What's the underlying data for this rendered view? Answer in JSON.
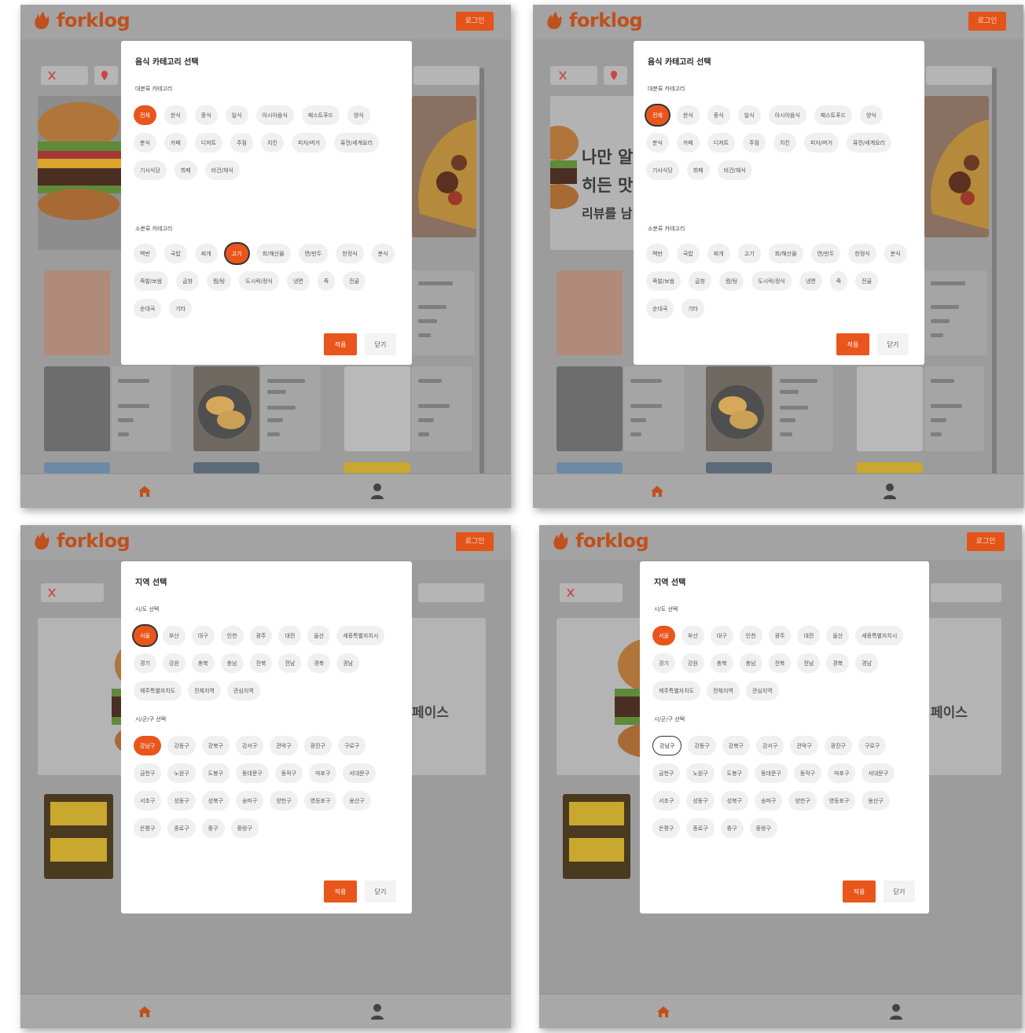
{
  "app": {
    "logo_text": "forklog",
    "login_label": "로그인"
  },
  "accent_color": "#e8561c",
  "icons": [
    "home-icon",
    "user-icon",
    "utensils-icon",
    "location-pin-icon",
    "forklog-logo-icon"
  ],
  "panel_1": {
    "modal_title": "음식 카테고리 선택",
    "major_label": "대분류 카테고리",
    "major_chips": [
      "전체",
      "한식",
      "중식",
      "일식",
      "아시아음식",
      "패스트푸드",
      "양식",
      "분식",
      "카페",
      "디저트",
      "주점",
      "치킨",
      "피자/버거",
      "퓨전/세계요리",
      "기사식당",
      "뷔페",
      "비건/채식"
    ],
    "minor_label": "소분류 카테고리",
    "minor_chips": [
      "백반",
      "국밥",
      "찌개",
      "고기",
      "회/해산물",
      "면/만두",
      "한정식",
      "분식",
      "족발/보쌈",
      "곱창",
      "찜/탕",
      "도시락/정식",
      "냉면",
      "죽",
      "전골",
      "순대국",
      "기타"
    ],
    "confirm_label": "적용",
    "cancel_label": "닫기"
  },
  "panel_2": {
    "modal_title": "음식 카테고리 선택",
    "major_label": "대분류 카테고리",
    "major_chips": [
      "전체",
      "한식",
      "중식",
      "일식",
      "아시아음식",
      "패스트푸드",
      "양식",
      "분식",
      "카페",
      "디저트",
      "주점",
      "치킨",
      "피자/버거",
      "퓨전/세계요리",
      "기사식당",
      "뷔페",
      "비건/채식"
    ],
    "minor_label": "소분류 카테고리",
    "minor_chips": [
      "백반",
      "국밥",
      "찌개",
      "고기",
      "회/해산물",
      "면/만두",
      "한정식",
      "분식",
      "족발/보쌈",
      "곱창",
      "찜/탕",
      "도시락/정식",
      "냉면",
      "죽",
      "전골",
      "순대국",
      "기타"
    ],
    "confirm_label": "적용",
    "cancel_label": "닫기",
    "banner_lines": [
      "나만 알",
      "히든 맛",
      "리뷰를 남"
    ]
  },
  "panel_3": {
    "modal_title": "지역 선택",
    "major_label": "시/도 선택",
    "major_chips": [
      "서울",
      "부산",
      "대구",
      "인천",
      "광주",
      "대전",
      "울산",
      "세종특별자치시",
      "경기",
      "강원",
      "충북",
      "충남",
      "전북",
      "전남",
      "경북",
      "경남",
      "제주특별자치도",
      "전체지역",
      "관심지역"
    ],
    "minor_label": "시/군/구 선택",
    "minor_chips": [
      "강남구",
      "강동구",
      "강북구",
      "강서구",
      "관악구",
      "광진구",
      "구로구",
      "금천구",
      "노원구",
      "도봉구",
      "동대문구",
      "동작구",
      "마포구",
      "서대문구",
      "서초구",
      "성동구",
      "성북구",
      "송파구",
      "양천구",
      "영등포구",
      "용산구",
      "은평구",
      "종로구",
      "중구",
      "중랑구"
    ],
    "confirm_label": "적용",
    "cancel_label": "닫기",
    "right_text": "페이스"
  },
  "panel_4": {
    "modal_title": "지역 선택",
    "major_label": "시/도 선택",
    "major_chips": [
      "서울",
      "부산",
      "대구",
      "인천",
      "광주",
      "대전",
      "울산",
      "세종특별자치시",
      "경기",
      "강원",
      "충북",
      "충남",
      "전북",
      "전남",
      "경북",
      "경남",
      "제주특별자치도",
      "전체지역",
      "관심지역"
    ],
    "minor_label": "시/군/구 선택",
    "minor_chips": [
      "강남구",
      "강동구",
      "강북구",
      "강서구",
      "관악구",
      "광진구",
      "구로구",
      "금천구",
      "노원구",
      "도봉구",
      "동대문구",
      "동작구",
      "마포구",
      "서대문구",
      "서초구",
      "성동구",
      "성북구",
      "송파구",
      "양천구",
      "영등포구",
      "용산구",
      "은평구",
      "종로구",
      "중구",
      "중랑구"
    ],
    "confirm_label": "적용",
    "cancel_label": "닫기",
    "right_text": "페이스"
  }
}
